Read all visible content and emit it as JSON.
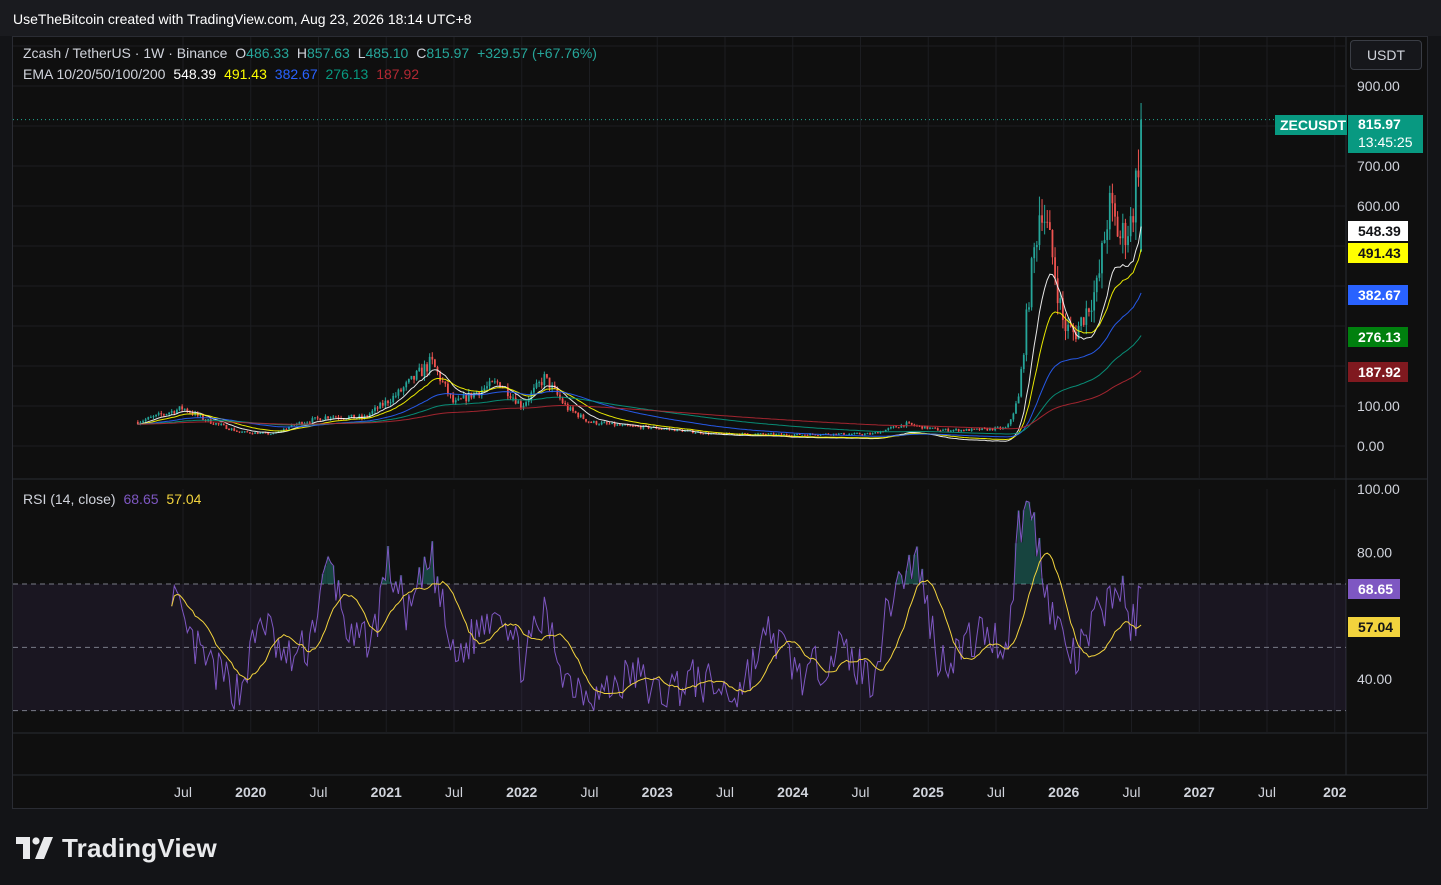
{
  "header": {
    "caption": "UseTheBitcoin created with TradingView.com, Aug 23, 2026 18:14 UTC+8"
  },
  "symbol": {
    "title": "Zcash / TetherUS · 1W · Binance",
    "o_label": "O",
    "o": "486.33",
    "h_label": "H",
    "h": "857.63",
    "l_label": "L",
    "l": "485.10",
    "c_label": "C",
    "c": "815.97",
    "change": "+329.57 (+67.76%)",
    "ticker": "ZECUSDT",
    "countdown": "13:45:25",
    "currency": "USDT"
  },
  "ema": {
    "label": "EMA 10/20/50/100/200",
    "values": [
      "548.39",
      "491.43",
      "382.67",
      "276.13",
      "187.92"
    ],
    "colors": [
      "#ffffff",
      "#ffff00",
      "#2962ff",
      "#089981",
      "#b22833"
    ],
    "badge_colors": [
      "#ffffff",
      "#ffff00",
      "#2962ff",
      "#00800e",
      "#80191f"
    ]
  },
  "rsi": {
    "label": "RSI (14, close)",
    "value": "68.65",
    "ma_value": "57.04",
    "color": "#7e57c2",
    "ma_color": "#f2d33d"
  },
  "colors": {
    "up": "#26a69a",
    "down": "#ef5350",
    "accent": "#22ab94"
  },
  "brand": {
    "name": "TradingView",
    "icon": "tradingview-logo-icon"
  },
  "chart_data": [
    {
      "type": "candlestick",
      "title": "Zcash / TetherUS · 1W · Binance",
      "x_range": [
        "2019-03",
        "2028-01"
      ],
      "y_ticks": [
        "900.00",
        "700.00",
        "600.00",
        "100.00",
        "0.00"
      ],
      "last_price": 815.97,
      "x_ticks": [
        "Jul",
        "2020",
        "Jul",
        "2021",
        "Jul",
        "2022",
        "Jul",
        "2023",
        "Jul",
        "2024",
        "Jul",
        "2025",
        "Jul",
        "2026",
        "Jul",
        "2027",
        "Jul",
        "202"
      ],
      "price_path": [
        [
          "2019-03",
          60
        ],
        [
          "2019-07",
          95
        ],
        [
          "2019-09",
          65
        ],
        [
          "2019-12",
          35
        ],
        [
          "2020-03",
          30
        ],
        [
          "2020-05",
          55
        ],
        [
          "2020-08",
          75
        ],
        [
          "2020-11",
          70
        ],
        [
          "2021-02",
          130
        ],
        [
          "2021-05",
          210
        ],
        [
          "2021-07",
          105
        ],
        [
          "2021-09",
          135
        ],
        [
          "2021-11",
          160
        ],
        [
          "2022-01",
          100
        ],
        [
          "2022-03",
          170
        ],
        [
          "2022-05",
          95
        ],
        [
          "2022-07",
          60
        ],
        [
          "2022-10",
          50
        ],
        [
          "2023-01",
          45
        ],
        [
          "2023-06",
          30
        ],
        [
          "2023-10",
          30
        ],
        [
          "2024-01",
          28
        ],
        [
          "2024-04",
          30
        ],
        [
          "2024-08",
          30
        ],
        [
          "2024-11",
          55
        ],
        [
          "2025-02",
          40
        ],
        [
          "2025-05",
          40
        ],
        [
          "2025-08",
          45
        ],
        [
          "2025-09",
          120
        ],
        [
          "2025-10",
          400
        ],
        [
          "2025-11",
          620
        ],
        [
          "2025-12",
          470
        ],
        [
          "2026-01",
          300
        ],
        [
          "2026-02",
          280
        ],
        [
          "2026-04",
          400
        ],
        [
          "2026-05",
          600
        ],
        [
          "2026-06",
          520
        ],
        [
          "2026-07",
          560
        ],
        [
          "2026-08",
          815.97
        ]
      ],
      "series": [
        {
          "name": "EMA 10",
          "last": 548.39
        },
        {
          "name": "EMA 20",
          "last": 491.43
        },
        {
          "name": "EMA 50",
          "last": 382.67
        },
        {
          "name": "EMA 100",
          "last": 276.13
        },
        {
          "name": "EMA 200",
          "last": 187.92
        }
      ]
    },
    {
      "type": "line",
      "title": "RSI (14, close)",
      "y_ticks": [
        "100.00",
        "80.00",
        "40.00"
      ],
      "ylim": [
        25,
        100
      ],
      "bands": [
        30,
        50,
        70
      ],
      "rsi_path": [
        [
          "2019-06",
          70
        ],
        [
          "2019-07",
          55
        ],
        [
          "2019-09",
          45
        ],
        [
          "2019-12",
          36
        ],
        [
          "2020-02",
          60
        ],
        [
          "2020-04",
          45
        ],
        [
          "2020-06",
          50
        ],
        [
          "2020-08",
          77
        ],
        [
          "2020-10",
          50
        ],
        [
          "2020-12",
          55
        ],
        [
          "2021-01",
          77
        ],
        [
          "2021-03",
          60
        ],
        [
          "2021-05",
          78
        ],
        [
          "2021-07",
          45
        ],
        [
          "2021-09",
          55
        ],
        [
          "2021-11",
          65
        ],
        [
          "2022-01",
          45
        ],
        [
          "2022-03",
          60
        ],
        [
          "2022-05",
          40
        ],
        [
          "2022-08",
          35
        ],
        [
          "2022-11",
          42
        ],
        [
          "2023-01",
          35
        ],
        [
          "2023-04",
          40
        ],
        [
          "2023-08",
          35
        ],
        [
          "2023-11",
          55
        ],
        [
          "2024-02",
          40
        ],
        [
          "2024-05",
          50
        ],
        [
          "2024-08",
          40
        ],
        [
          "2024-10",
          70
        ],
        [
          "2024-12",
          78
        ],
        [
          "2025-02",
          45
        ],
        [
          "2025-04",
          50
        ],
        [
          "2025-06",
          55
        ],
        [
          "2025-08",
          50
        ],
        [
          "2025-09",
          88
        ],
        [
          "2025-10",
          95
        ],
        [
          "2025-12",
          60
        ],
        [
          "2026-02",
          45
        ],
        [
          "2026-04",
          60
        ],
        [
          "2026-06",
          70
        ],
        [
          "2026-07",
          55
        ],
        [
          "2026-08",
          68.65
        ]
      ],
      "rsi_ma_last": 57.04
    }
  ]
}
